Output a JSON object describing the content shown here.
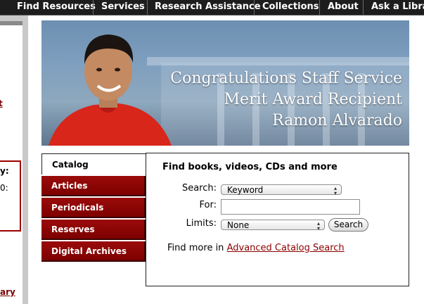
{
  "nav": {
    "items": [
      "Find Resources",
      "Services",
      "Research Assistance",
      "Collections",
      "About",
      "Ask a Librar"
    ]
  },
  "left": {
    "fragments": [
      "t",
      "y:",
      "0:",
      "s",
      "ary"
    ]
  },
  "banner": {
    "caption_lines": [
      "Congratulations Staff Service",
      "Merit Award Recipient",
      "Ramon Alvarado"
    ]
  },
  "tabs": [
    {
      "label": "Catalog",
      "active": true
    },
    {
      "label": "Articles",
      "active": false
    },
    {
      "label": "Periodicals",
      "active": false
    },
    {
      "label": "Reserves",
      "active": false
    },
    {
      "label": "Digital Archives",
      "active": false
    }
  ],
  "search": {
    "heading": "Find books, videos, CDs and more",
    "search_label": "Search:",
    "search_value": "Keyword",
    "for_label": "For:",
    "for_value": "",
    "limits_label": "Limits:",
    "limits_value": "None",
    "button_label": "Search",
    "more_prefix": "Find more in",
    "more_link": "Advanced Catalog Search"
  },
  "colors": {
    "accent": "#8b0000",
    "nav_bg": "#1d1d1d"
  }
}
